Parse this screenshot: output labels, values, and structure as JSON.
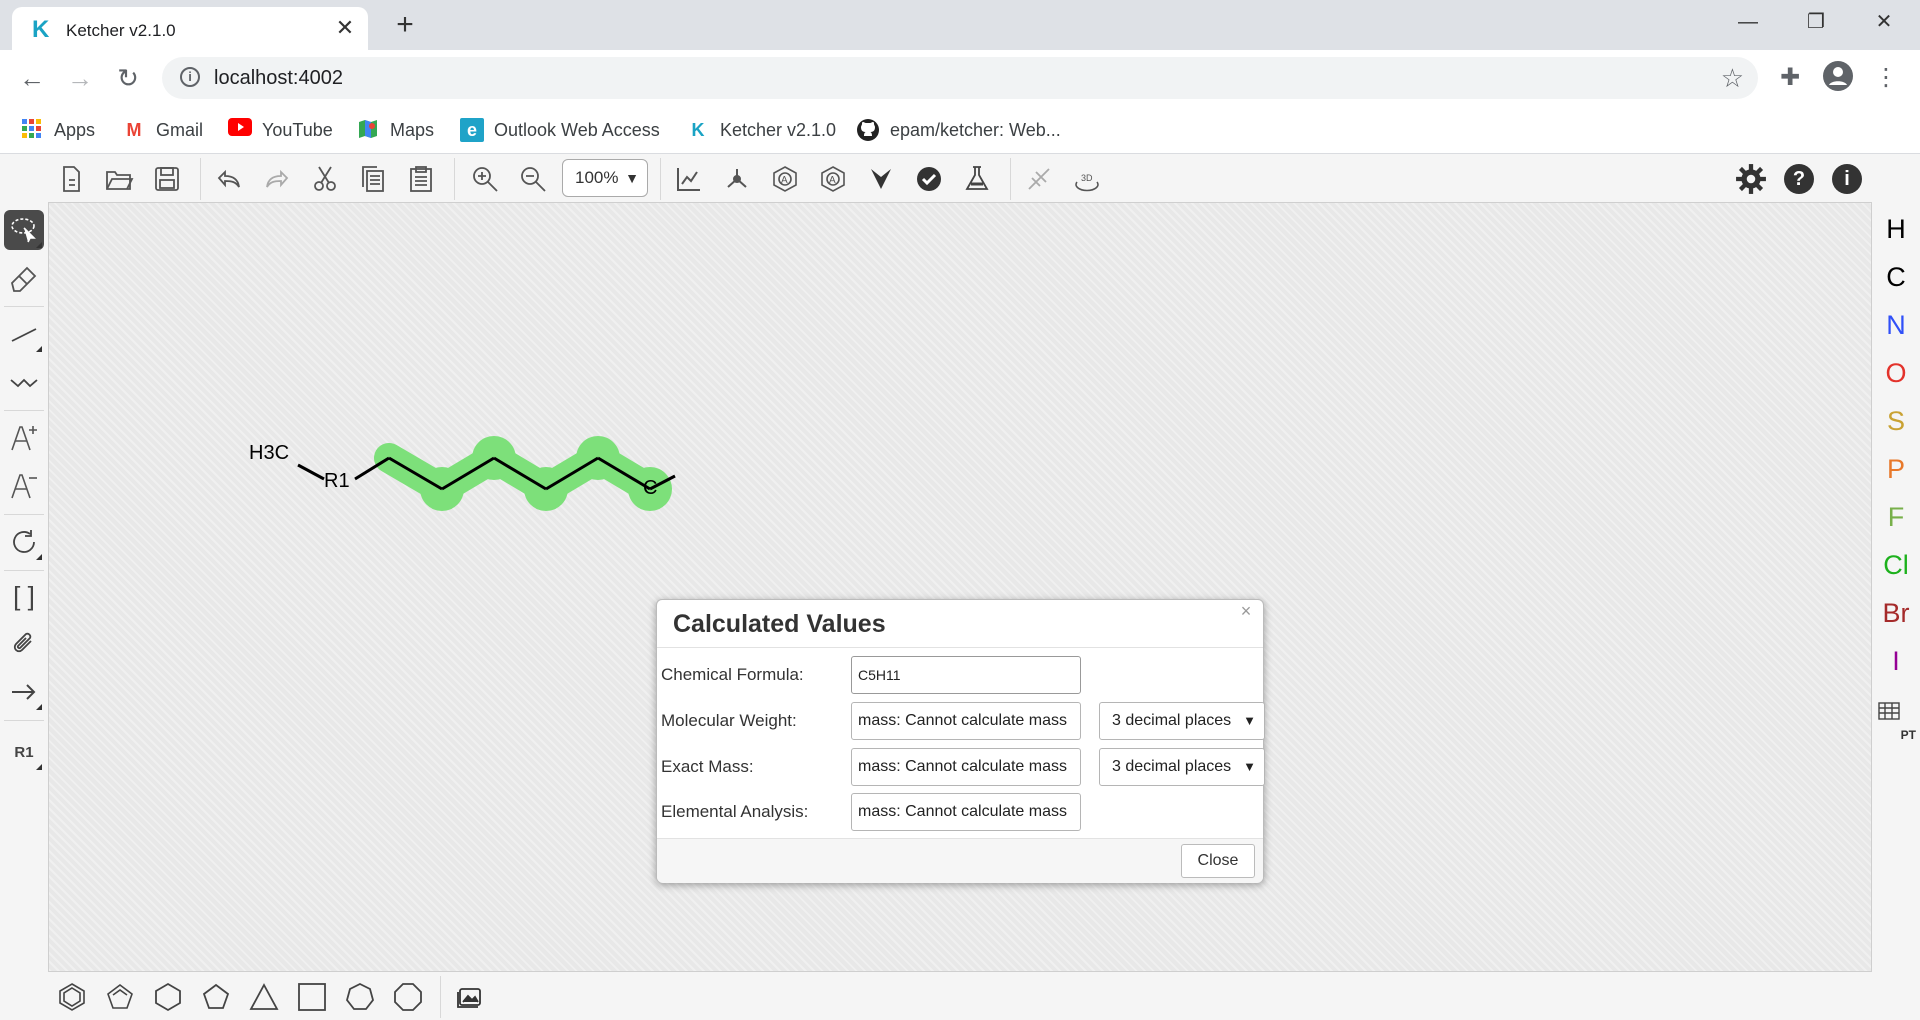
{
  "browser": {
    "tab_title": "Ketcher v2.1.0",
    "favicon_letter": "K",
    "url": "localhost:4002",
    "bookmarks": [
      {
        "label": "Apps"
      },
      {
        "label": "Gmail"
      },
      {
        "label": "YouTube"
      },
      {
        "label": "Maps"
      },
      {
        "label": "Outlook Web Access"
      },
      {
        "label": "Ketcher v2.1.0"
      },
      {
        "label": "epam/ketcher: Web..."
      }
    ]
  },
  "toolbar": {
    "zoom_value": "100%"
  },
  "left_tools": {
    "template_label": "R1"
  },
  "atoms": [
    {
      "symbol": "H",
      "color": "#000000"
    },
    {
      "symbol": "C",
      "color": "#000000"
    },
    {
      "symbol": "N",
      "color": "#3050F8"
    },
    {
      "symbol": "O",
      "color": "#E3322B"
    },
    {
      "symbol": "S",
      "color": "#C9A233"
    },
    {
      "symbol": "P",
      "color": "#E8792B"
    },
    {
      "symbol": "F",
      "color": "#78B04A"
    },
    {
      "symbol": "Cl",
      "color": "#1DB11D"
    },
    {
      "symbol": "Br",
      "color": "#A52A2A"
    },
    {
      "symbol": "I",
      "color": "#940094"
    }
  ],
  "periodic_table_label": "PT",
  "molecule": {
    "h3c_label": "H3C",
    "r1_label": "R1",
    "c_label": "C",
    "highlight_color": "#7de07a"
  },
  "dialog": {
    "title": "Calculated Values",
    "close_x": "×",
    "formula_label": "Chemical Formula:",
    "formula_value": "C5H11",
    "mw_label": "Molecular Weight:",
    "mw_value": "mass: Cannot calculate mass",
    "mw_precision": "3 decimal places",
    "exact_label": "Exact Mass:",
    "exact_value": "mass: Cannot calculate mass",
    "exact_precision": "3 decimal places",
    "ea_label": "Elemental Analysis:",
    "ea_value": "mass: Cannot calculate mass",
    "close_button": "Close"
  }
}
